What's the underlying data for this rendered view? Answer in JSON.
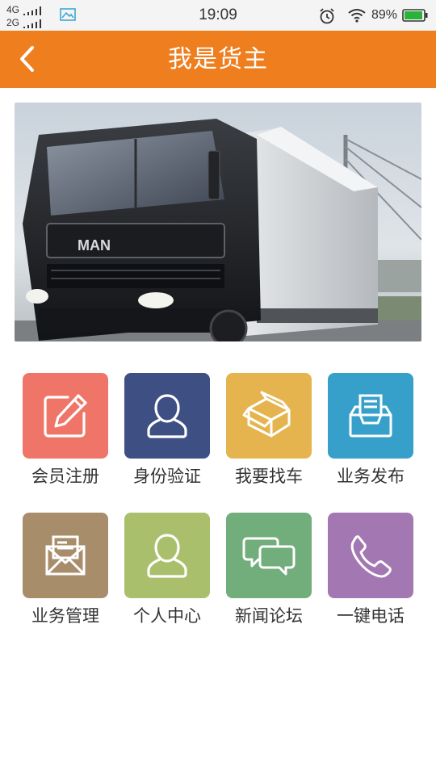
{
  "status_bar": {
    "network_1": "4G",
    "network_2": "2G",
    "time": "19:09",
    "battery_percent": "89%",
    "icons": [
      "signal-icon",
      "gallery-icon",
      "alarm-icon",
      "wifi-icon",
      "battery-icon"
    ]
  },
  "header": {
    "title": "我是货主",
    "background_color": "#ee7e1e"
  },
  "banner": {
    "alt": "truck-photo",
    "truck_brand_text": "MAN"
  },
  "menu": {
    "items": [
      {
        "label": "会员注册",
        "icon": "pencil-edit-icon",
        "color": "#ef7568"
      },
      {
        "label": "身份验证",
        "icon": "user-icon",
        "color": "#3d4f83"
      },
      {
        "label": "我要找车",
        "icon": "package-box-icon",
        "color": "#e5b44f"
      },
      {
        "label": "业务发布",
        "icon": "inbox-tray-icon",
        "color": "#36a0cb"
      },
      {
        "label": "业务管理",
        "icon": "envelope-icon",
        "color": "#a88d6b"
      },
      {
        "label": "个人中心",
        "icon": "user-icon",
        "color": "#a9bf6b"
      },
      {
        "label": "新闻论坛",
        "icon": "chat-bubbles-icon",
        "color": "#72ae7c"
      },
      {
        "label": "一键电话",
        "icon": "phone-icon",
        "color": "#a378b2"
      }
    ]
  }
}
